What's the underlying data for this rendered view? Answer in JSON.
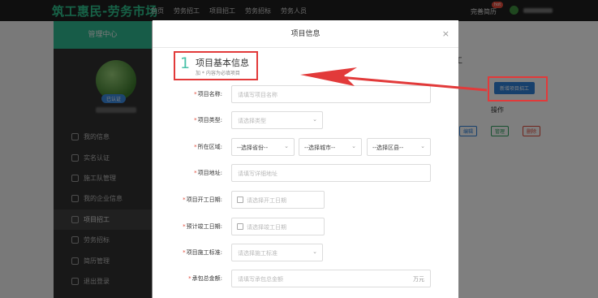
{
  "header": {
    "logo": "筑工惠民-劳务市场",
    "nav": [
      "首页",
      "劳务招工",
      "项目招工",
      "劳务招标",
      "劳务人员"
    ],
    "complete_resume": "完善简历",
    "badge": "hot"
  },
  "sidebar": {
    "title": "管理中心",
    "cert_badge": "已认证",
    "items": [
      {
        "label": "我的信息",
        "active": false
      },
      {
        "label": "实名认证",
        "active": false
      },
      {
        "label": "施工队管理",
        "active": false
      },
      {
        "label": "我的企业信息",
        "active": false
      },
      {
        "label": "项目招工",
        "active": true
      },
      {
        "label": "劳务招标",
        "active": false
      },
      {
        "label": "简历管理",
        "active": false
      },
      {
        "label": "退出登录",
        "active": false
      }
    ]
  },
  "background": {
    "title_fragment": "工",
    "add_button": "新增项目招工",
    "operation_header": "操作",
    "actions": [
      "编辑",
      "管理",
      "删除"
    ]
  },
  "modal": {
    "title": "项目信息",
    "close": "×",
    "section": {
      "number": "1",
      "title": "项目基本信息",
      "subtitle": "加 * 内容为必填项目"
    },
    "fields": {
      "name": {
        "label": "项目名称:",
        "placeholder": "请填写项目名称"
      },
      "type": {
        "label": "项目类型:",
        "placeholder": "请选择类型"
      },
      "region": {
        "label": "所在区域:",
        "province": "--选择省份--",
        "city": "--选择城市--",
        "district": "--选择区县--"
      },
      "address": {
        "label": "项目地址:",
        "placeholder": "请填写详细地址"
      },
      "start_date": {
        "label": "项目开工日期:",
        "placeholder": "请选择开工日期"
      },
      "end_date": {
        "label": "预计竣工日期:",
        "placeholder": "请选择竣工日期"
      },
      "standard": {
        "label": "项目施工标准:",
        "placeholder": "请选择施工标准"
      },
      "amount": {
        "label": "承包总金额:",
        "placeholder": "请填写承包总金额",
        "unit": "万元"
      }
    },
    "required_mark": "*"
  },
  "annotation": {
    "color": "#e23a3a"
  }
}
